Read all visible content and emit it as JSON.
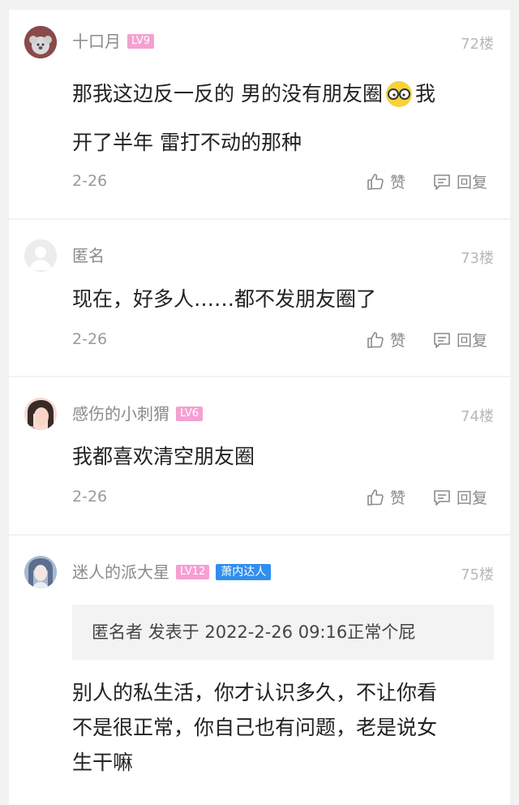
{
  "comments": [
    {
      "username": "十口月",
      "level": "LV9",
      "floor": "72楼",
      "content_lines": [
        "那我这边反一反的 男的没有朋友圈",
        "我",
        "开了半年 雷打不动的那种"
      ],
      "date": "2-26",
      "like_label": "赞",
      "reply_label": "回复"
    },
    {
      "username": "匿名",
      "floor": "73楼",
      "content_lines": [
        "现在，好多人……都不发朋友圈了"
      ],
      "date": "2-26",
      "like_label": "赞",
      "reply_label": "回复"
    },
    {
      "username": "感伤的小刺猬",
      "level": "LV6",
      "floor": "74楼",
      "content_lines": [
        "我都喜欢清空朋友圈"
      ],
      "date": "2-26",
      "like_label": "赞",
      "reply_label": "回复"
    },
    {
      "username": "迷人的派大星",
      "level": "LV12",
      "badge": "萧内达人",
      "floor": "75楼",
      "quote": "匿名者 发表于 2022-2-26 09:16正常个屁",
      "content_lines": [
        "别人的私生活，你才认识多久，不让你看",
        "不是很正常，你自己也有问题，老是说女",
        "生干嘛"
      ]
    }
  ],
  "colors": {
    "level_badge": "#f4a0d2",
    "talent_badge": "#2f8ff0",
    "background": "#f2f2f2"
  },
  "icons": [
    "thumb-up-icon",
    "comment-icon",
    "glasses-emoji-icon"
  ]
}
